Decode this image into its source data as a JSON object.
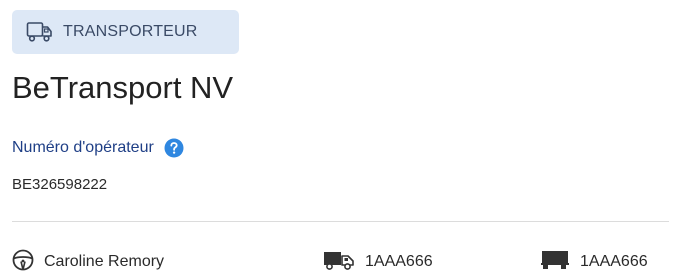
{
  "badge": {
    "icon": "truck-outline-icon",
    "label": "TRANSPORTEUR"
  },
  "company": {
    "name": "BeTransport NV"
  },
  "operator": {
    "label": "Numéro d'opérateur",
    "help_icon": "help-circle-icon",
    "value": "BE326598222"
  },
  "footer": {
    "driver": {
      "icon": "steering-wheel-icon",
      "name": "Caroline Remory"
    },
    "truck": {
      "icon": "truck-icon",
      "plate": "1AAA666"
    },
    "trailer": {
      "icon": "trailer-icon",
      "plate": "1AAA666"
    }
  },
  "colors": {
    "badge_bg": "#dde8f6",
    "label_blue": "#1f3f86",
    "help_blue": "#2f87e0",
    "text_dark": "#222222"
  }
}
